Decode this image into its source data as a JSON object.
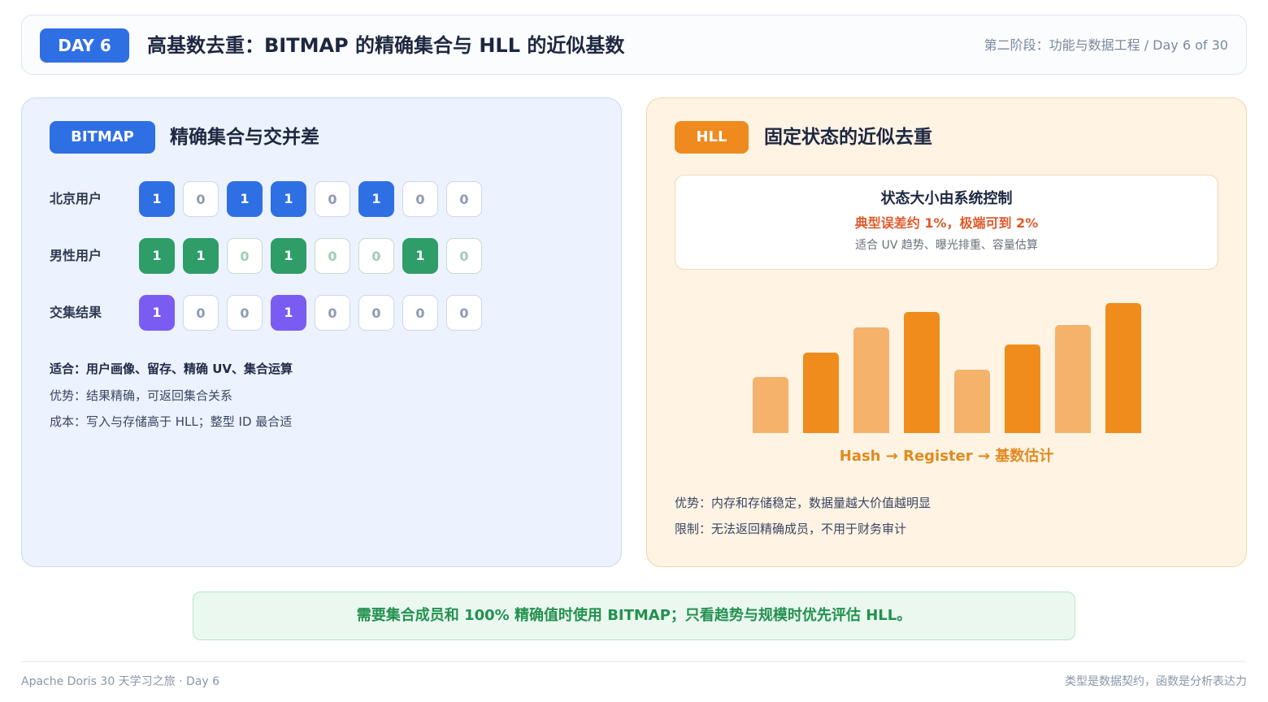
{
  "header": {
    "badge": "DAY 6",
    "title": "高基数去重：BITMAP 的精确集合与 HLL 的近似基数",
    "meta": "第二阶段：功能与数据工程 / Day 6 of 30"
  },
  "bitmap": {
    "tag": "BITMAP",
    "heading": "精确集合与交并差",
    "rows": [
      {
        "label": "北京用户",
        "bits": [
          "1",
          "0",
          "1",
          "1",
          "0",
          "1",
          "0",
          "0"
        ],
        "style": "blue"
      },
      {
        "label": "男性用户",
        "bits": [
          "1",
          "1",
          "0",
          "1",
          "0",
          "0",
          "1",
          "0"
        ],
        "style": "green"
      },
      {
        "label": "交集结果",
        "bits": [
          "1",
          "0",
          "0",
          "1",
          "0",
          "0",
          "0",
          "0"
        ],
        "style": "purple"
      }
    ],
    "fit": "适合：用户画像、留存、精确 UV、集合运算",
    "advantage": "优势：结果精确，可返回集合关系",
    "cost": "成本：写入与存储高于 HLL；整型 ID 最合适"
  },
  "hll": {
    "tag": "HLL",
    "heading": "固定状态的近似去重",
    "state_title": "状态大小由系统控制",
    "state_error": "典型误差约 1%，极端可到 2%",
    "state_use": "适合 UV 趋势、曝光排重、容量估算",
    "register_bars": [
      {
        "level": 0.43,
        "tone": "light"
      },
      {
        "level": 0.62,
        "tone": "dark"
      },
      {
        "level": 0.81,
        "tone": "light"
      },
      {
        "level": 0.93,
        "tone": "dark"
      },
      {
        "level": 0.49,
        "tone": "light"
      },
      {
        "level": 0.68,
        "tone": "dark"
      },
      {
        "level": 0.83,
        "tone": "light"
      },
      {
        "level": 1.0,
        "tone": "dark"
      }
    ],
    "flow": "Hash → Register → 基数估计",
    "advantage": "优势：内存和存储稳定，数据量越大价值越明显",
    "limit": "限制：无法返回精确成员，不用于财务审计"
  },
  "summary": "需要集合成员和 100% 精确值时使用 BITMAP；只看趋势与规模时优先评估 HLL。",
  "footer": {
    "left": "Apache Doris 30 天学习之旅 · Day 6",
    "right": "类型是数据契约，函数是分析表达力"
  },
  "colors": {
    "blue": "#2f6fe4",
    "green": "#2e9d68",
    "purple": "#7b5cf2",
    "orange": "#ee8a1e",
    "summary_green": "#23914f"
  }
}
